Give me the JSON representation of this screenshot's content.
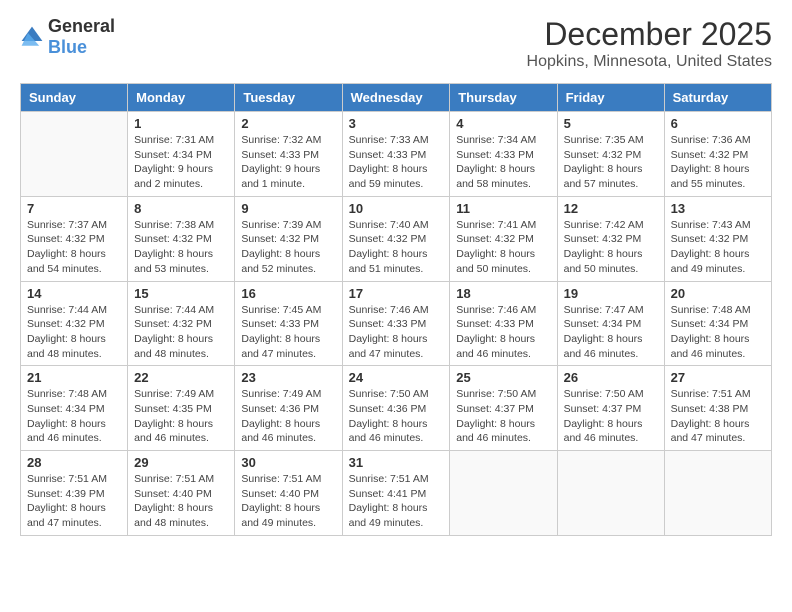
{
  "header": {
    "logo_general": "General",
    "logo_blue": "Blue",
    "month_title": "December 2025",
    "location": "Hopkins, Minnesota, United States"
  },
  "weekdays": [
    "Sunday",
    "Monday",
    "Tuesday",
    "Wednesday",
    "Thursday",
    "Friday",
    "Saturday"
  ],
  "weeks": [
    [
      {
        "day": "",
        "sunrise": "",
        "sunset": "",
        "daylight": ""
      },
      {
        "day": "1",
        "sunrise": "Sunrise: 7:31 AM",
        "sunset": "Sunset: 4:34 PM",
        "daylight": "Daylight: 9 hours and 2 minutes."
      },
      {
        "day": "2",
        "sunrise": "Sunrise: 7:32 AM",
        "sunset": "Sunset: 4:33 PM",
        "daylight": "Daylight: 9 hours and 1 minute."
      },
      {
        "day": "3",
        "sunrise": "Sunrise: 7:33 AM",
        "sunset": "Sunset: 4:33 PM",
        "daylight": "Daylight: 8 hours and 59 minutes."
      },
      {
        "day": "4",
        "sunrise": "Sunrise: 7:34 AM",
        "sunset": "Sunset: 4:33 PM",
        "daylight": "Daylight: 8 hours and 58 minutes."
      },
      {
        "day": "5",
        "sunrise": "Sunrise: 7:35 AM",
        "sunset": "Sunset: 4:32 PM",
        "daylight": "Daylight: 8 hours and 57 minutes."
      },
      {
        "day": "6",
        "sunrise": "Sunrise: 7:36 AM",
        "sunset": "Sunset: 4:32 PM",
        "daylight": "Daylight: 8 hours and 55 minutes."
      }
    ],
    [
      {
        "day": "7",
        "sunrise": "Sunrise: 7:37 AM",
        "sunset": "Sunset: 4:32 PM",
        "daylight": "Daylight: 8 hours and 54 minutes."
      },
      {
        "day": "8",
        "sunrise": "Sunrise: 7:38 AM",
        "sunset": "Sunset: 4:32 PM",
        "daylight": "Daylight: 8 hours and 53 minutes."
      },
      {
        "day": "9",
        "sunrise": "Sunrise: 7:39 AM",
        "sunset": "Sunset: 4:32 PM",
        "daylight": "Daylight: 8 hours and 52 minutes."
      },
      {
        "day": "10",
        "sunrise": "Sunrise: 7:40 AM",
        "sunset": "Sunset: 4:32 PM",
        "daylight": "Daylight: 8 hours and 51 minutes."
      },
      {
        "day": "11",
        "sunrise": "Sunrise: 7:41 AM",
        "sunset": "Sunset: 4:32 PM",
        "daylight": "Daylight: 8 hours and 50 minutes."
      },
      {
        "day": "12",
        "sunrise": "Sunrise: 7:42 AM",
        "sunset": "Sunset: 4:32 PM",
        "daylight": "Daylight: 8 hours and 50 minutes."
      },
      {
        "day": "13",
        "sunrise": "Sunrise: 7:43 AM",
        "sunset": "Sunset: 4:32 PM",
        "daylight": "Daylight: 8 hours and 49 minutes."
      }
    ],
    [
      {
        "day": "14",
        "sunrise": "Sunrise: 7:44 AM",
        "sunset": "Sunset: 4:32 PM",
        "daylight": "Daylight: 8 hours and 48 minutes."
      },
      {
        "day": "15",
        "sunrise": "Sunrise: 7:44 AM",
        "sunset": "Sunset: 4:32 PM",
        "daylight": "Daylight: 8 hours and 48 minutes."
      },
      {
        "day": "16",
        "sunrise": "Sunrise: 7:45 AM",
        "sunset": "Sunset: 4:33 PM",
        "daylight": "Daylight: 8 hours and 47 minutes."
      },
      {
        "day": "17",
        "sunrise": "Sunrise: 7:46 AM",
        "sunset": "Sunset: 4:33 PM",
        "daylight": "Daylight: 8 hours and 47 minutes."
      },
      {
        "day": "18",
        "sunrise": "Sunrise: 7:46 AM",
        "sunset": "Sunset: 4:33 PM",
        "daylight": "Daylight: 8 hours and 46 minutes."
      },
      {
        "day": "19",
        "sunrise": "Sunrise: 7:47 AM",
        "sunset": "Sunset: 4:34 PM",
        "daylight": "Daylight: 8 hours and 46 minutes."
      },
      {
        "day": "20",
        "sunrise": "Sunrise: 7:48 AM",
        "sunset": "Sunset: 4:34 PM",
        "daylight": "Daylight: 8 hours and 46 minutes."
      }
    ],
    [
      {
        "day": "21",
        "sunrise": "Sunrise: 7:48 AM",
        "sunset": "Sunset: 4:34 PM",
        "daylight": "Daylight: 8 hours and 46 minutes."
      },
      {
        "day": "22",
        "sunrise": "Sunrise: 7:49 AM",
        "sunset": "Sunset: 4:35 PM",
        "daylight": "Daylight: 8 hours and 46 minutes."
      },
      {
        "day": "23",
        "sunrise": "Sunrise: 7:49 AM",
        "sunset": "Sunset: 4:36 PM",
        "daylight": "Daylight: 8 hours and 46 minutes."
      },
      {
        "day": "24",
        "sunrise": "Sunrise: 7:50 AM",
        "sunset": "Sunset: 4:36 PM",
        "daylight": "Daylight: 8 hours and 46 minutes."
      },
      {
        "day": "25",
        "sunrise": "Sunrise: 7:50 AM",
        "sunset": "Sunset: 4:37 PM",
        "daylight": "Daylight: 8 hours and 46 minutes."
      },
      {
        "day": "26",
        "sunrise": "Sunrise: 7:50 AM",
        "sunset": "Sunset: 4:37 PM",
        "daylight": "Daylight: 8 hours and 46 minutes."
      },
      {
        "day": "27",
        "sunrise": "Sunrise: 7:51 AM",
        "sunset": "Sunset: 4:38 PM",
        "daylight": "Daylight: 8 hours and 47 minutes."
      }
    ],
    [
      {
        "day": "28",
        "sunrise": "Sunrise: 7:51 AM",
        "sunset": "Sunset: 4:39 PM",
        "daylight": "Daylight: 8 hours and 47 minutes."
      },
      {
        "day": "29",
        "sunrise": "Sunrise: 7:51 AM",
        "sunset": "Sunset: 4:40 PM",
        "daylight": "Daylight: 8 hours and 48 minutes."
      },
      {
        "day": "30",
        "sunrise": "Sunrise: 7:51 AM",
        "sunset": "Sunset: 4:40 PM",
        "daylight": "Daylight: 8 hours and 49 minutes."
      },
      {
        "day": "31",
        "sunrise": "Sunrise: 7:51 AM",
        "sunset": "Sunset: 4:41 PM",
        "daylight": "Daylight: 8 hours and 49 minutes."
      },
      {
        "day": "",
        "sunrise": "",
        "sunset": "",
        "daylight": ""
      },
      {
        "day": "",
        "sunrise": "",
        "sunset": "",
        "daylight": ""
      },
      {
        "day": "",
        "sunrise": "",
        "sunset": "",
        "daylight": ""
      }
    ]
  ]
}
